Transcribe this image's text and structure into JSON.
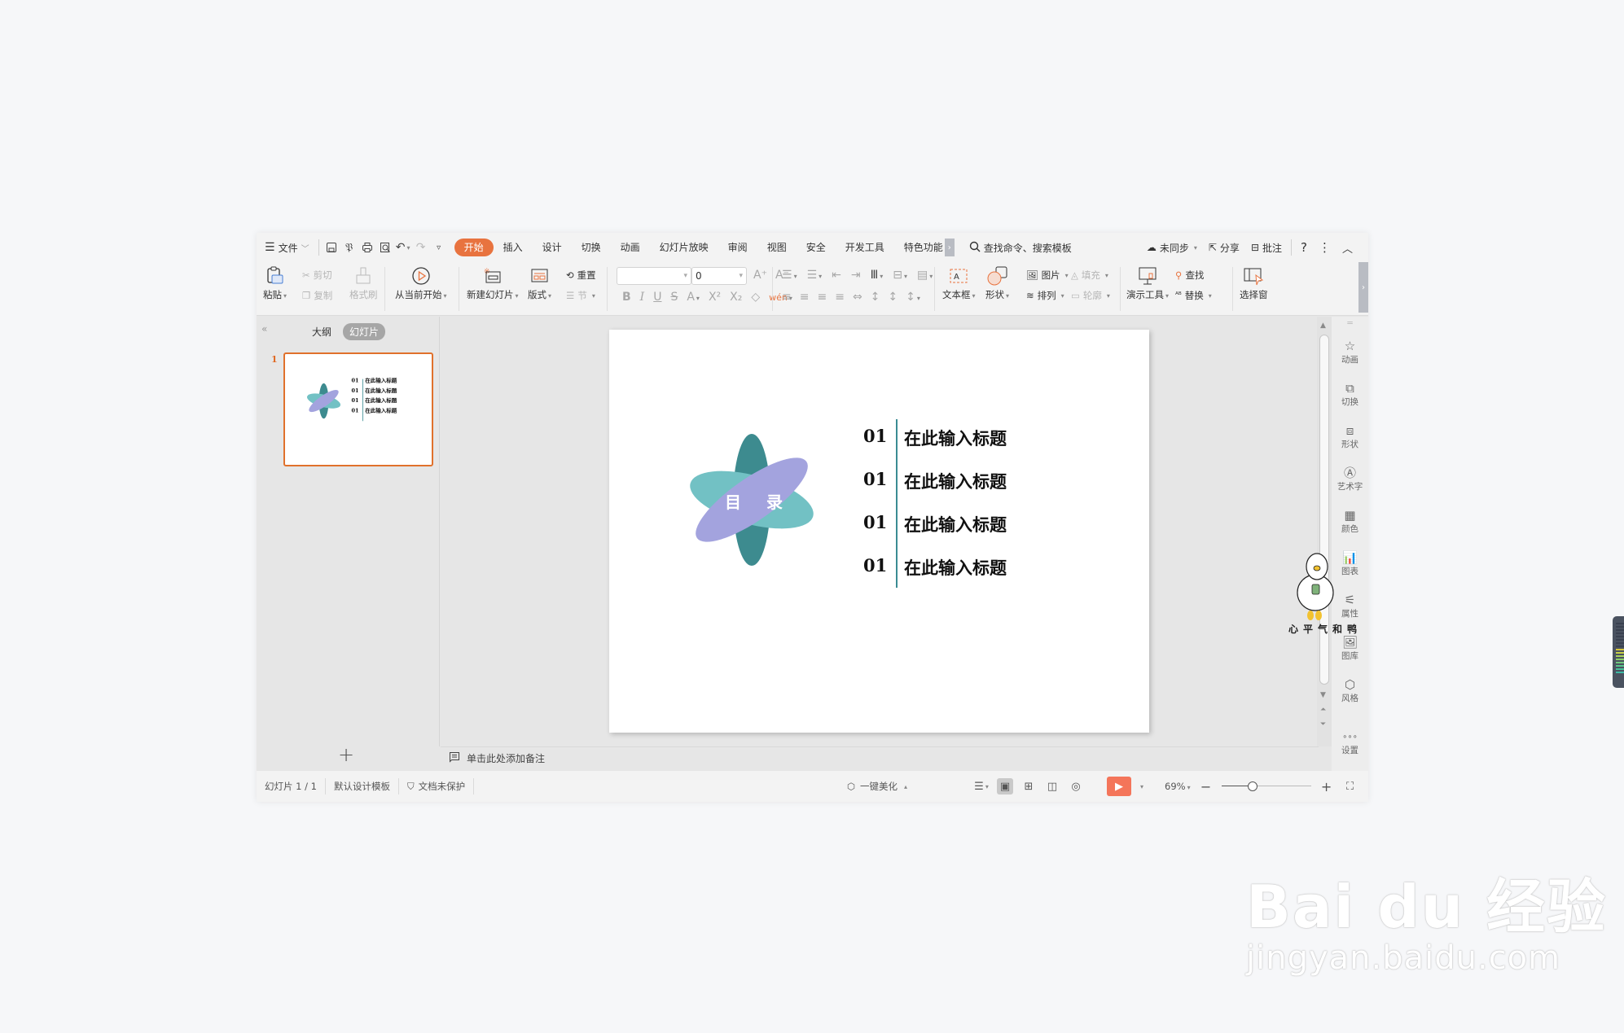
{
  "tabrow": {
    "menu_label": "文件",
    "tabs": [
      {
        "label": "开始",
        "active": true
      },
      {
        "label": "插入"
      },
      {
        "label": "设计"
      },
      {
        "label": "切换"
      },
      {
        "label": "动画"
      },
      {
        "label": "幻灯片放映"
      },
      {
        "label": "审阅"
      },
      {
        "label": "视图"
      },
      {
        "label": "安全"
      },
      {
        "label": "开发工具"
      },
      {
        "label": "特色功能"
      }
    ],
    "search_placeholder": "查找命令、搜索模板",
    "sync_label": "未同步",
    "share_label": "分享",
    "comment_label": "批注",
    "help_label": "?"
  },
  "ribbon": {
    "paste": "粘贴",
    "cut": "剪切",
    "copy": "复制",
    "format_painter": "格式刷",
    "play_from_current": "从当前开始",
    "new_slide": "新建幻灯片",
    "layout": "版式",
    "reset": "重置",
    "section": "节",
    "font_name": "",
    "font_size": "0",
    "textbox": "文本框",
    "shape": "形状",
    "picture": "图片",
    "fill": "填充",
    "arrange": "排列",
    "outline": "轮廓",
    "presentation_tools": "演示工具",
    "find": "查找",
    "replace": "替换",
    "selection_pane": "选择窗"
  },
  "left_panel": {
    "tab_outline": "大纲",
    "tab_slides": "幻灯片",
    "slide_number": "1"
  },
  "slide": {
    "center_label": "目 录",
    "items": [
      {
        "num": "01",
        "title": "在此输入标题"
      },
      {
        "num": "01",
        "title": "在此输入标题"
      },
      {
        "num": "01",
        "title": "在此输入标题"
      },
      {
        "num": "01",
        "title": "在此输入标题"
      }
    ],
    "colors": {
      "teal_dark": "#3d8b8f",
      "teal_light": "#72c1c4",
      "lavender": "#a3a3de",
      "divider": "#3a8c93"
    }
  },
  "right_sidebar": [
    {
      "label": "动画",
      "icon": "animation-icon"
    },
    {
      "label": "切换",
      "icon": "transition-icon"
    },
    {
      "label": "形状",
      "icon": "shape-icon"
    },
    {
      "label": "艺术字",
      "icon": "wordart-icon"
    },
    {
      "label": "颜色",
      "icon": "color-icon"
    },
    {
      "label": "图表",
      "icon": "chart-icon"
    },
    {
      "label": "属性",
      "icon": "properties-icon"
    },
    {
      "label": "图库",
      "icon": "gallery-icon"
    },
    {
      "label": "风格",
      "icon": "style-icon"
    },
    {
      "label": "设置",
      "icon": "settings-icon"
    }
  ],
  "notes_placeholder": "单击此处添加备注",
  "status": {
    "slide_counter": "幻灯片 1 / 1",
    "template": "默认设计模板",
    "protection": "文档未保护",
    "beautify": "一键美化",
    "zoom_level": "69%",
    "zoom_fraction": 0.35
  },
  "overlay": {
    "duck_caption": "心平气和鸭",
    "watermark_main": "Bai du 经验",
    "watermark_url": "jingyan.baidu.com"
  }
}
